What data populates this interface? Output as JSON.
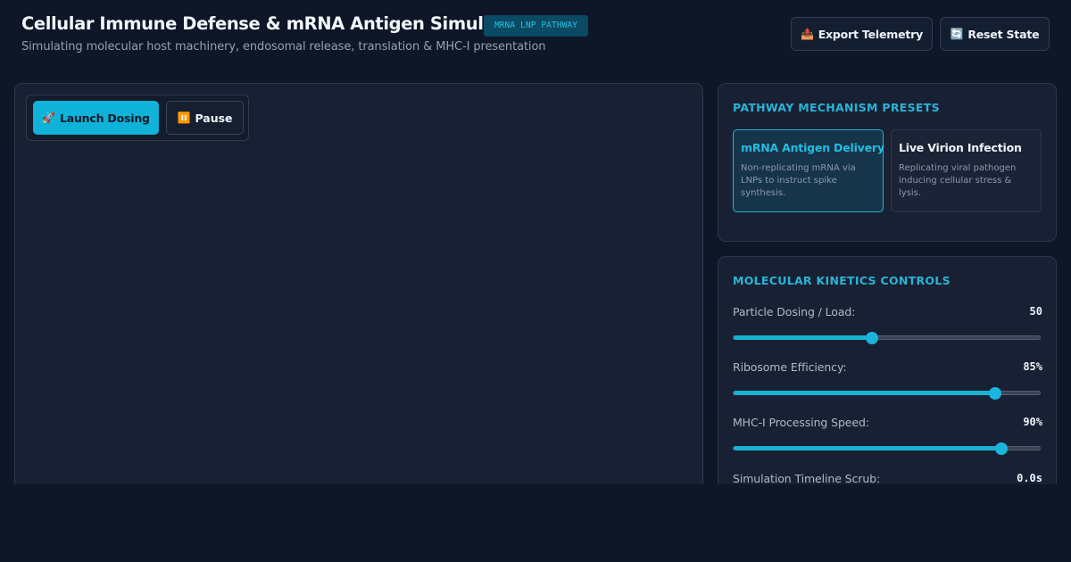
{
  "header": {
    "title": "Cellular Immune Defense & mRNA Antigen Simulator",
    "badge": "MRNA LNP PATHWAY",
    "subtitle": "Simulating molecular host machinery, endosomal release, translation & MHC-I presentation",
    "export_icon": "📤",
    "export_label": "Export Telemetry",
    "reset_icon": "🔄",
    "reset_label": "Reset State"
  },
  "sim_controls": {
    "launch_icon": "🚀",
    "launch_label": "Launch Dosing",
    "pause_icon": "⏸️",
    "pause_label": "Pause"
  },
  "presets": {
    "title": "PATHWAY MECHANISM PRESETS",
    "items": [
      {
        "name": "mRNA Antigen Delivery",
        "description": "Non-replicating mRNA via LNPs to instruct spike synthesis.",
        "active": true
      },
      {
        "name": "Live Virion Infection",
        "description": "Replicating viral pathogen inducing cellular stress & lysis.",
        "active": false
      }
    ]
  },
  "kinetics": {
    "title": "MOLECULAR KINETICS CONTROLS",
    "sliders": [
      {
        "label": "Particle Dosing / Load:",
        "value": "50",
        "fraction": 0.45
      },
      {
        "label": "Ribosome Efficiency:",
        "value": "85%",
        "fraction": 0.85
      },
      {
        "label": "MHC-I Processing Speed:",
        "value": "90%",
        "fraction": 0.87
      },
      {
        "label": "Simulation Timeline Scrub:",
        "value": "0.0s",
        "fraction": 0.0
      }
    ]
  },
  "colors": {
    "background": "#0e1628",
    "panel": "#182133",
    "accent": "#1ab0d4"
  }
}
